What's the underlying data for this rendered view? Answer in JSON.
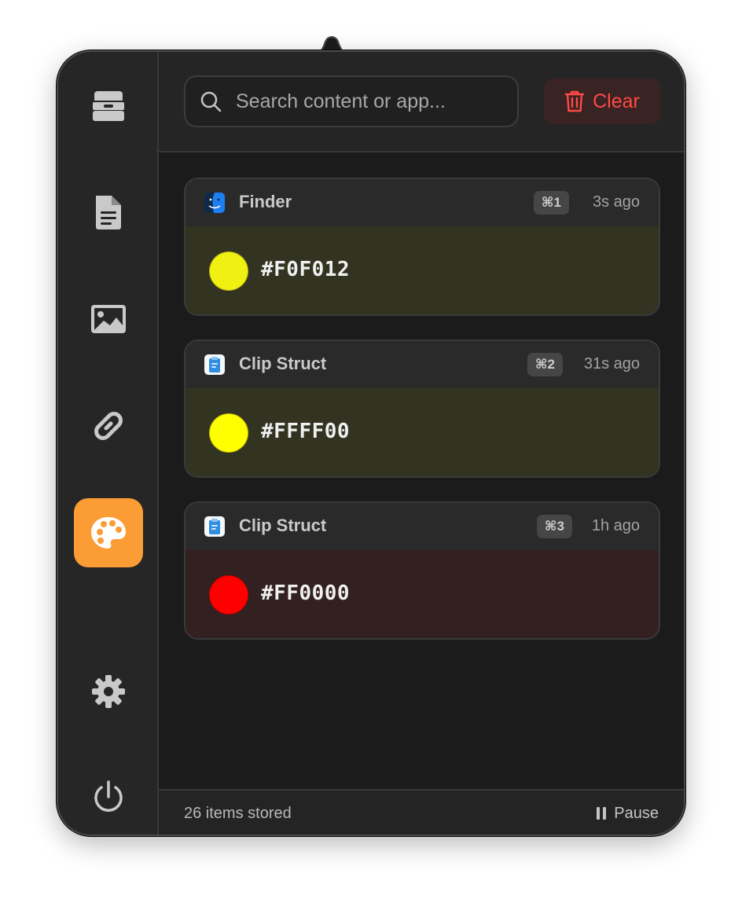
{
  "sidebar": {
    "items": [
      {
        "icon": "tray-icon",
        "active": false
      },
      {
        "icon": "document-icon",
        "active": false
      },
      {
        "icon": "image-icon",
        "active": false
      },
      {
        "icon": "link-icon",
        "active": false
      },
      {
        "icon": "palette-icon",
        "active": true
      },
      {
        "icon": "gear-icon",
        "active": false
      },
      {
        "icon": "power-icon",
        "active": false
      }
    ],
    "active_color": "#fb9c35"
  },
  "header": {
    "search_placeholder": "Search content or app...",
    "search_value": "",
    "clear_label": "Clear",
    "clear_color": "#ff4a45"
  },
  "items": [
    {
      "app": "Finder",
      "app_icon": "finder-icon",
      "shortcut": "⌘1",
      "time": "3s ago",
      "hex": "#F0F012",
      "swatch": "#F0F012",
      "tint": "#333322"
    },
    {
      "app": "Clip Struct",
      "app_icon": "clipboard-icon",
      "shortcut": "⌘2",
      "time": "31s ago",
      "hex": "#FFFF00",
      "swatch": "#FFFF00",
      "tint": "#333322"
    },
    {
      "app": "Clip Struct",
      "app_icon": "clipboard-icon",
      "shortcut": "⌘3",
      "time": "1h ago",
      "hex": "#FF0000",
      "swatch": "#FF0000",
      "tint": "#332020"
    }
  ],
  "footer": {
    "count_text": "26 items stored",
    "pause_label": "Pause"
  }
}
